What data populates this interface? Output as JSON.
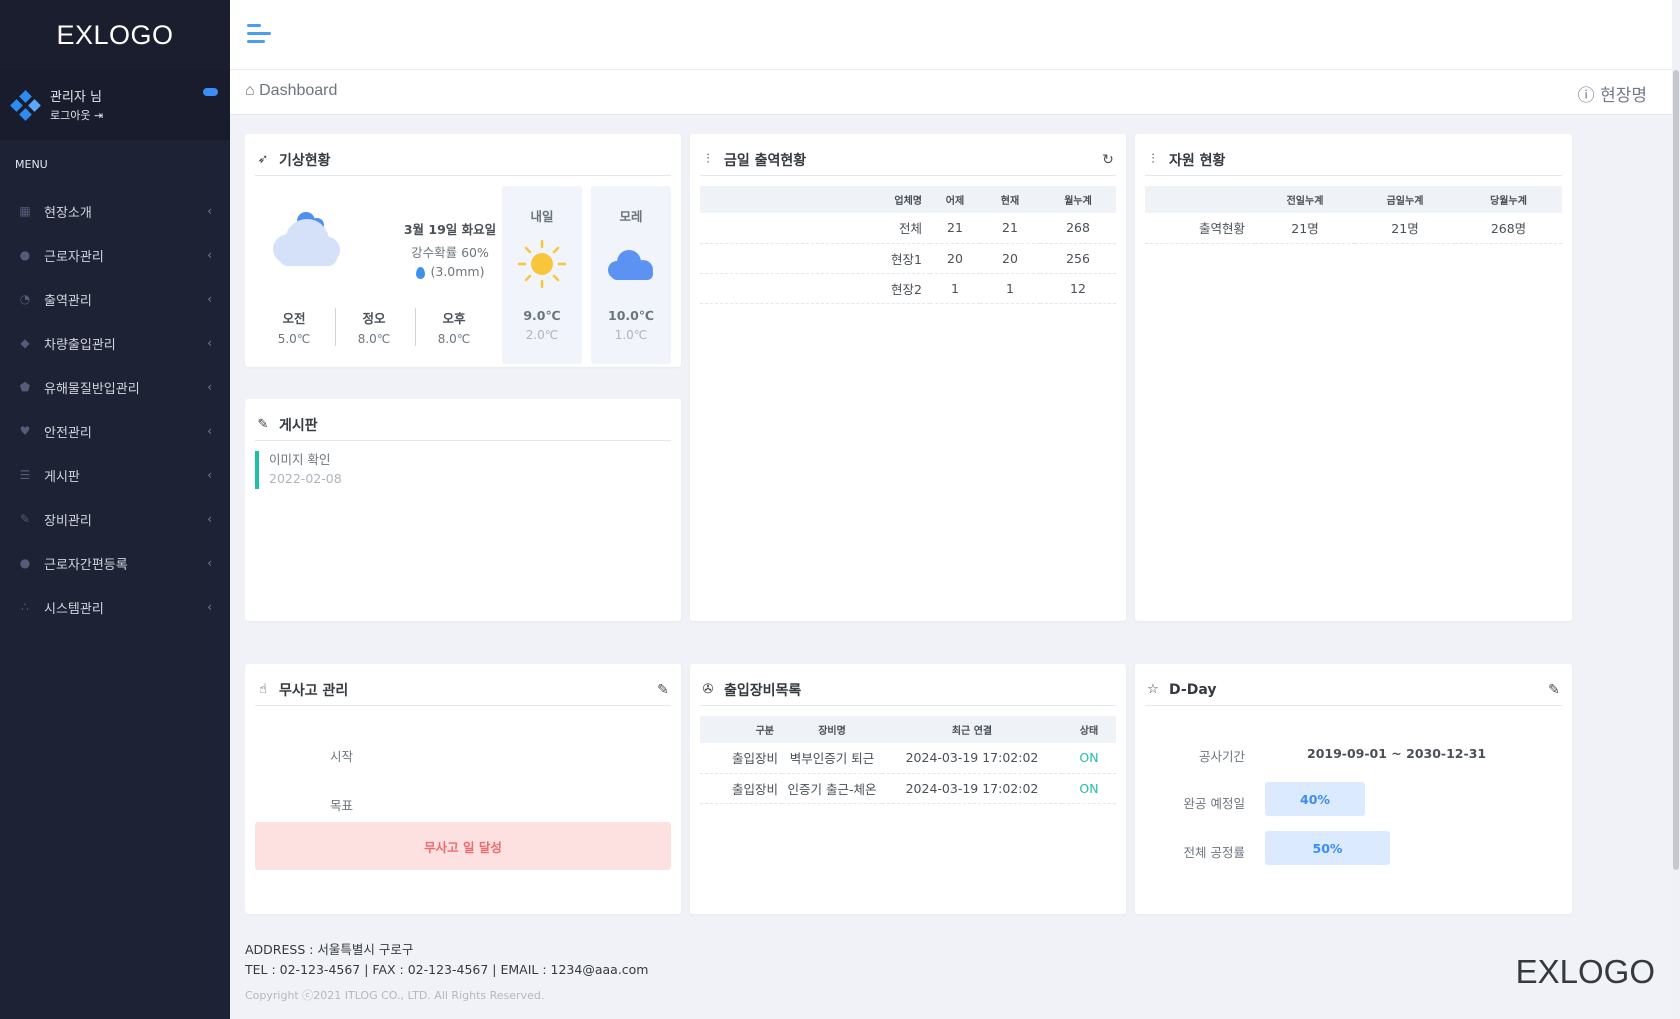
{
  "brand": "EXLOGO",
  "user": {
    "name": "관리자 님",
    "logout": "로그아웃 ⇥"
  },
  "menu_title": "MENU",
  "menu": [
    {
      "label": "현장소개",
      "icon": "building-icon",
      "glyph": "▦"
    },
    {
      "label": "근로자관리",
      "icon": "user-icon",
      "glyph": "●"
    },
    {
      "label": "출역관리",
      "icon": "pie-chart-icon",
      "glyph": "◔"
    },
    {
      "label": "차량출입관리",
      "icon": "layers-icon",
      "glyph": "◆"
    },
    {
      "label": "유해물질반입관리",
      "icon": "shield-icon",
      "glyph": "⬟"
    },
    {
      "label": "안전관리",
      "icon": "heart-icon",
      "glyph": "♥"
    },
    {
      "label": "게시판",
      "icon": "list-icon",
      "glyph": "☰"
    },
    {
      "label": "장비관리",
      "icon": "wrench-icon",
      "glyph": "✎"
    },
    {
      "label": "근로자간편등록",
      "icon": "users-icon",
      "glyph": "●"
    },
    {
      "label": "시스템관리",
      "icon": "nodes-icon",
      "glyph": "∴"
    }
  ],
  "breadcrumb": "⌂ Dashboard",
  "site_name": "ⓘ 현장명",
  "weather": {
    "title": "기상현황",
    "date": "3월 19일 화요일",
    "rain_chance": "강수확률 60%",
    "rain_amount": "(3.0mm)",
    "slots": [
      {
        "name": "오전",
        "temp": "5.0℃"
      },
      {
        "name": "정오",
        "temp": "8.0℃"
      },
      {
        "name": "오후",
        "temp": "8.0℃"
      }
    ],
    "forecast": [
      {
        "day": "내일",
        "icon": "sun-icon",
        "high": "9.0℃",
        "low": "2.0℃"
      },
      {
        "day": "모레",
        "icon": "cloud-icon",
        "high": "10.0℃",
        "low": "1.0℃"
      }
    ]
  },
  "attendance": {
    "title": "금일 출역현황",
    "headers": [
      "업체명",
      "어제",
      "현재",
      "월누계"
    ],
    "rows": [
      [
        "전체",
        "21",
        "21",
        "268"
      ],
      [
        "현장1",
        "20",
        "20",
        "256"
      ],
      [
        "현장2",
        "1",
        "1",
        "12"
      ]
    ]
  },
  "resources": {
    "title": "자원 현황",
    "headers": [
      "",
      "전일누계",
      "금일누계",
      "당월누계"
    ],
    "rows": [
      [
        "출역현황",
        "21명",
        "21명",
        "268명"
      ]
    ]
  },
  "board": {
    "title": "게시판",
    "posts": [
      {
        "title": "이미지 확인",
        "date": "2022-02-08"
      }
    ]
  },
  "safety": {
    "title": "무사고 관리",
    "start_label": "시작",
    "goal_label": "목표",
    "achieve": "무사고 일 달성"
  },
  "equipment": {
    "title": "출입장비목록",
    "headers": [
      "구분",
      "장비명",
      "최근 연결",
      "상태"
    ],
    "rows": [
      [
        "출입장비",
        "벽부인증기 퇴근",
        "2024-03-19 17:02:02",
        "ON"
      ],
      [
        "출입장비",
        "인증기 출근-체온",
        "2024-03-19 17:02:02",
        "ON"
      ]
    ]
  },
  "dday": {
    "title": "D-Day",
    "period_label": "공사기간",
    "period_value": "2019-09-01 ~ 2030-12-31",
    "completion_label": "완공 예정일",
    "completion_pct": "40%",
    "completion_fraction": 0.4,
    "progress_label": "전체 공정률",
    "progress_pct": "50%",
    "progress_fraction": 0.5
  },
  "footer": {
    "address": "ADDRESS : 서울특별시 구로구",
    "contact": "TEL : 02-123-4567 | FAX : 02-123-4567 | EMAIL : 1234@aaa.com",
    "copyright": "Copyright ⓒ2021 ITLOG CO., LTD. All Rights Reserved.",
    "logo": "EXLOGO"
  },
  "colors": {
    "sidebar": "#1e2235",
    "accent": "#3b8df5",
    "teal": "#1fc1a6",
    "danger_bg": "#fde1e1",
    "danger_text": "#f06a6a"
  }
}
